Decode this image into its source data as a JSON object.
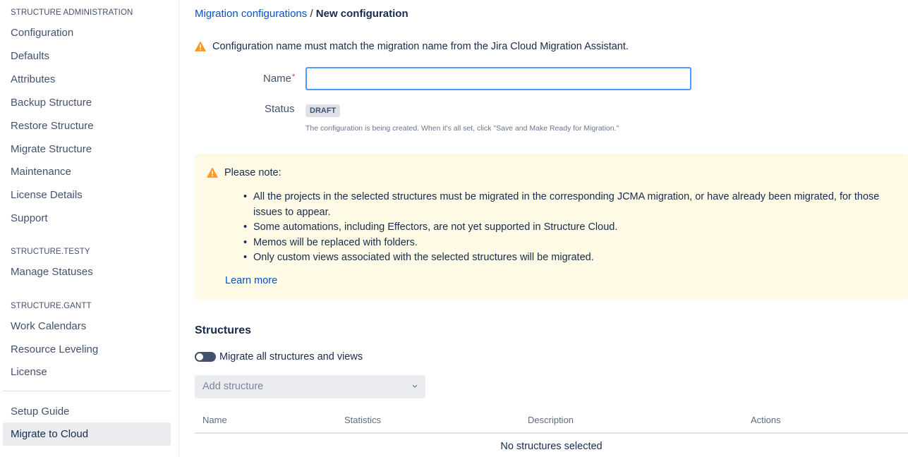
{
  "sidebar": {
    "sections": [
      {
        "heading": "STRUCTURE ADMINISTRATION",
        "items": [
          "Configuration",
          "Defaults",
          "Attributes",
          "Backup Structure",
          "Restore Structure",
          "Migrate Structure",
          "Maintenance",
          "License Details",
          "Support"
        ]
      },
      {
        "heading": "STRUCTURE.TESTY",
        "items": [
          "Manage Statuses"
        ]
      },
      {
        "heading": "STRUCTURE.GANTT",
        "items": [
          "Work Calendars",
          "Resource Leveling",
          "License"
        ]
      }
    ],
    "footer_items": [
      "Setup Guide",
      "Migrate to Cloud"
    ],
    "selected": "Migrate to Cloud"
  },
  "breadcrumb": {
    "parent": "Migration configurations",
    "separator": "/",
    "current": "New configuration"
  },
  "warning": "Configuration name must match the migration name from the Jira Cloud Migration Assistant.",
  "form": {
    "name_label": "Name",
    "required_mark": "*",
    "name_value": "",
    "status_label": "Status",
    "status_value": "DRAFT",
    "status_help": "The configuration is being created. When it's all set, click \"Save and Make Ready for Migration.\""
  },
  "note": {
    "title": "Please note:",
    "items": [
      "All the projects in the selected structures must be migrated in the corresponding JCMA migration, or have already been migrated, for those issues to appear.",
      "Some automations, including Effectors, are not yet supported in Structure Cloud.",
      "Memos will be replaced with folders.",
      "Only custom views associated with the selected structures will be migrated."
    ],
    "link": "Learn more"
  },
  "structures": {
    "title": "Structures",
    "toggle_label": "Migrate all structures and views",
    "toggle_on": false,
    "select_placeholder": "Add structure",
    "columns": [
      "Name",
      "Statistics",
      "Description",
      "Actions"
    ],
    "empty_text": "No structures selected"
  },
  "colors": {
    "link": "#0052cc",
    "warning": "#ff991f",
    "note_bg": "#fffae6",
    "input_focus": "#4c9aff"
  }
}
